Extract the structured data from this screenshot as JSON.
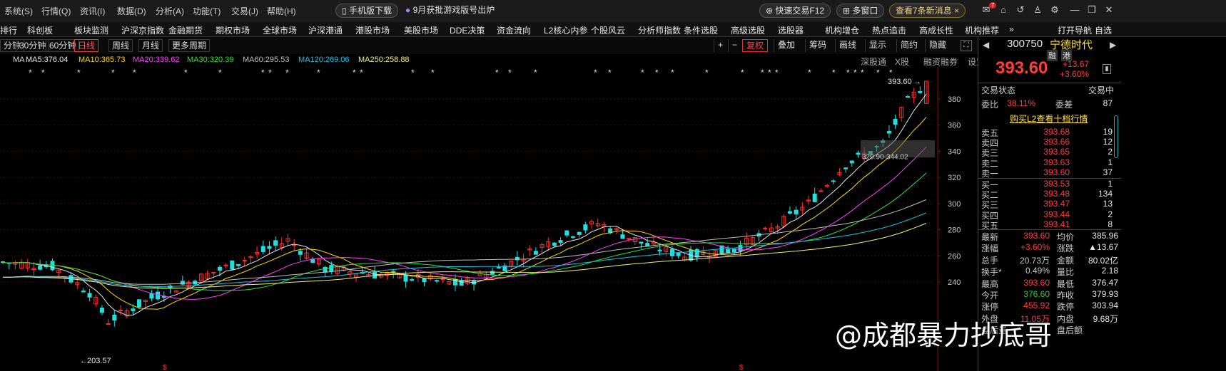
{
  "menu": {
    "items": [
      "系统(S)",
      "行情(Q)",
      "资讯(I)",
      "数据(D)",
      "分析(A)",
      "功能(T)",
      "交易(J)",
      "帮助(H)"
    ],
    "mobile_download": "手机版下载",
    "promo": "9月获批游戏版号出炉",
    "quick_trade": "快速交易F12",
    "multi_window": "多窗口",
    "news": "查看7条新消息",
    "mail_badge": "7"
  },
  "nav": {
    "items": [
      "排行",
      "科创板",
      "板块监测",
      "沪深京指数",
      "金融期货",
      "期权市场",
      "全球市场",
      "沪深港通",
      "港股市场",
      "美股市场",
      "DDE决策",
      "资金流向",
      "L2核心内参",
      "个股风云",
      "分析师指数",
      "条件选股",
      "高级选股",
      "选股器",
      "机构增仓",
      "热点追击",
      "高成长性",
      "机构推荐"
    ],
    "more": "»",
    "open_nav": "打开导航",
    "extra": "自选"
  },
  "period": {
    "tabs": [
      "分钟",
      "30分钟",
      "60分钟",
      "日线",
      "周线",
      "月线",
      "更多周期"
    ],
    "active": "日线",
    "tools": [
      "+",
      "−",
      "复权",
      "叠加",
      "筹码",
      "画线",
      "显示",
      "简约",
      "隐藏"
    ]
  },
  "ma": {
    "label": "MA",
    "lines": [
      {
        "text": "MA5:376.04",
        "color": "#e8e8e8"
      },
      {
        "text": "MA10:365.73",
        "color": "#ffd700"
      },
      {
        "text": "MA20:339.62",
        "color": "#ff40ff"
      },
      {
        "text": "MA30:320.39",
        "color": "#30e030"
      },
      {
        "text": "MA60:295.53",
        "color": "#bfbfbf"
      },
      {
        "text": "MA120:269.06",
        "color": "#20c0e0"
      },
      {
        "text": "MA250:258.88",
        "color": "#f0f080"
      }
    ]
  },
  "subtabs": [
    "深股通",
    "X股",
    "融资融券",
    "设置均线"
  ],
  "chart_data": {
    "type": "candlestick",
    "y_ticks": [
      240,
      260,
      280,
      300,
      320,
      340,
      360,
      380
    ],
    "high_label": "393.60",
    "low_label": "203.57",
    "range_label": "329.90-344.02",
    "ma_values": {
      "MA5": 376.04,
      "MA10": 365.73,
      "MA20": 339.62,
      "MA30": 320.39,
      "MA60": 295.53,
      "MA120": 269.06,
      "MA250": 258.88
    }
  },
  "quote": {
    "code": "300750",
    "name": "宁德时代",
    "tags": [
      "融",
      "港"
    ],
    "price": "393.60",
    "change": "+13.67",
    "change_pct": "+3.60%",
    "state_label": "交易状态",
    "state_value": "交易中",
    "weibi_label": "委比",
    "weibi": "38.11%",
    "weicha_label": "委差",
    "weicha": "87",
    "l2_link": "购买L2查看十档行情",
    "asks": [
      {
        "label": "卖五",
        "price": "393.68",
        "vol": "19"
      },
      {
        "label": "卖四",
        "price": "393.66",
        "vol": "12"
      },
      {
        "label": "卖三",
        "price": "393.65",
        "vol": "2"
      },
      {
        "label": "卖二",
        "price": "393.63",
        "vol": "1"
      },
      {
        "label": "卖一",
        "price": "393.60",
        "vol": "37"
      }
    ],
    "bids": [
      {
        "label": "买一",
        "price": "393.53",
        "vol": "1"
      },
      {
        "label": "买二",
        "price": "393.48",
        "vol": "134"
      },
      {
        "label": "买三",
        "price": "393.47",
        "vol": "13"
      },
      {
        "label": "买四",
        "price": "393.44",
        "vol": "2"
      },
      {
        "label": "买五",
        "price": "393.41",
        "vol": "8"
      }
    ],
    "stats": [
      {
        "l1": "最新",
        "v1": "393.60",
        "c1": "red",
        "l2": "均价",
        "v2": "385.96",
        "c2": "red"
      },
      {
        "l1": "涨幅",
        "v1": "+3.60%",
        "c1": "red",
        "l2": "涨跌",
        "v2": "▲13.67",
        "c2": "red"
      },
      {
        "l1": "总手",
        "v1": "20.73万",
        "c1": "",
        "l2": "金额",
        "v2": "80.02亿",
        "c2": "yel"
      },
      {
        "l1": "换手*",
        "v1": "0.49%",
        "c1": "",
        "l2": "量比",
        "v2": "2.18",
        "c2": "red"
      },
      {
        "l1": "最高",
        "v1": "393.60",
        "c1": "red",
        "l2": "最低",
        "v2": "376.47",
        "c2": "grn"
      },
      {
        "l1": "今开",
        "v1": "376.60",
        "c1": "grn",
        "l2": "昨收",
        "v2": "379.93",
        "c2": ""
      },
      {
        "l1": "涨停",
        "v1": "455.92",
        "c1": "red",
        "l2": "跌停",
        "v2": "303.94",
        "c2": "grn"
      },
      {
        "l1": "外盘",
        "v1": "11.05万",
        "c1": "red",
        "l2": "内盘",
        "v2": "9.68万",
        "c2": "grn"
      },
      {
        "l1": "盘后量",
        "v1": "",
        "c1": "",
        "l2": "盘后额",
        "v2": "",
        "c2": ""
      }
    ]
  },
  "watermark": "@成都暴力抄底哥"
}
